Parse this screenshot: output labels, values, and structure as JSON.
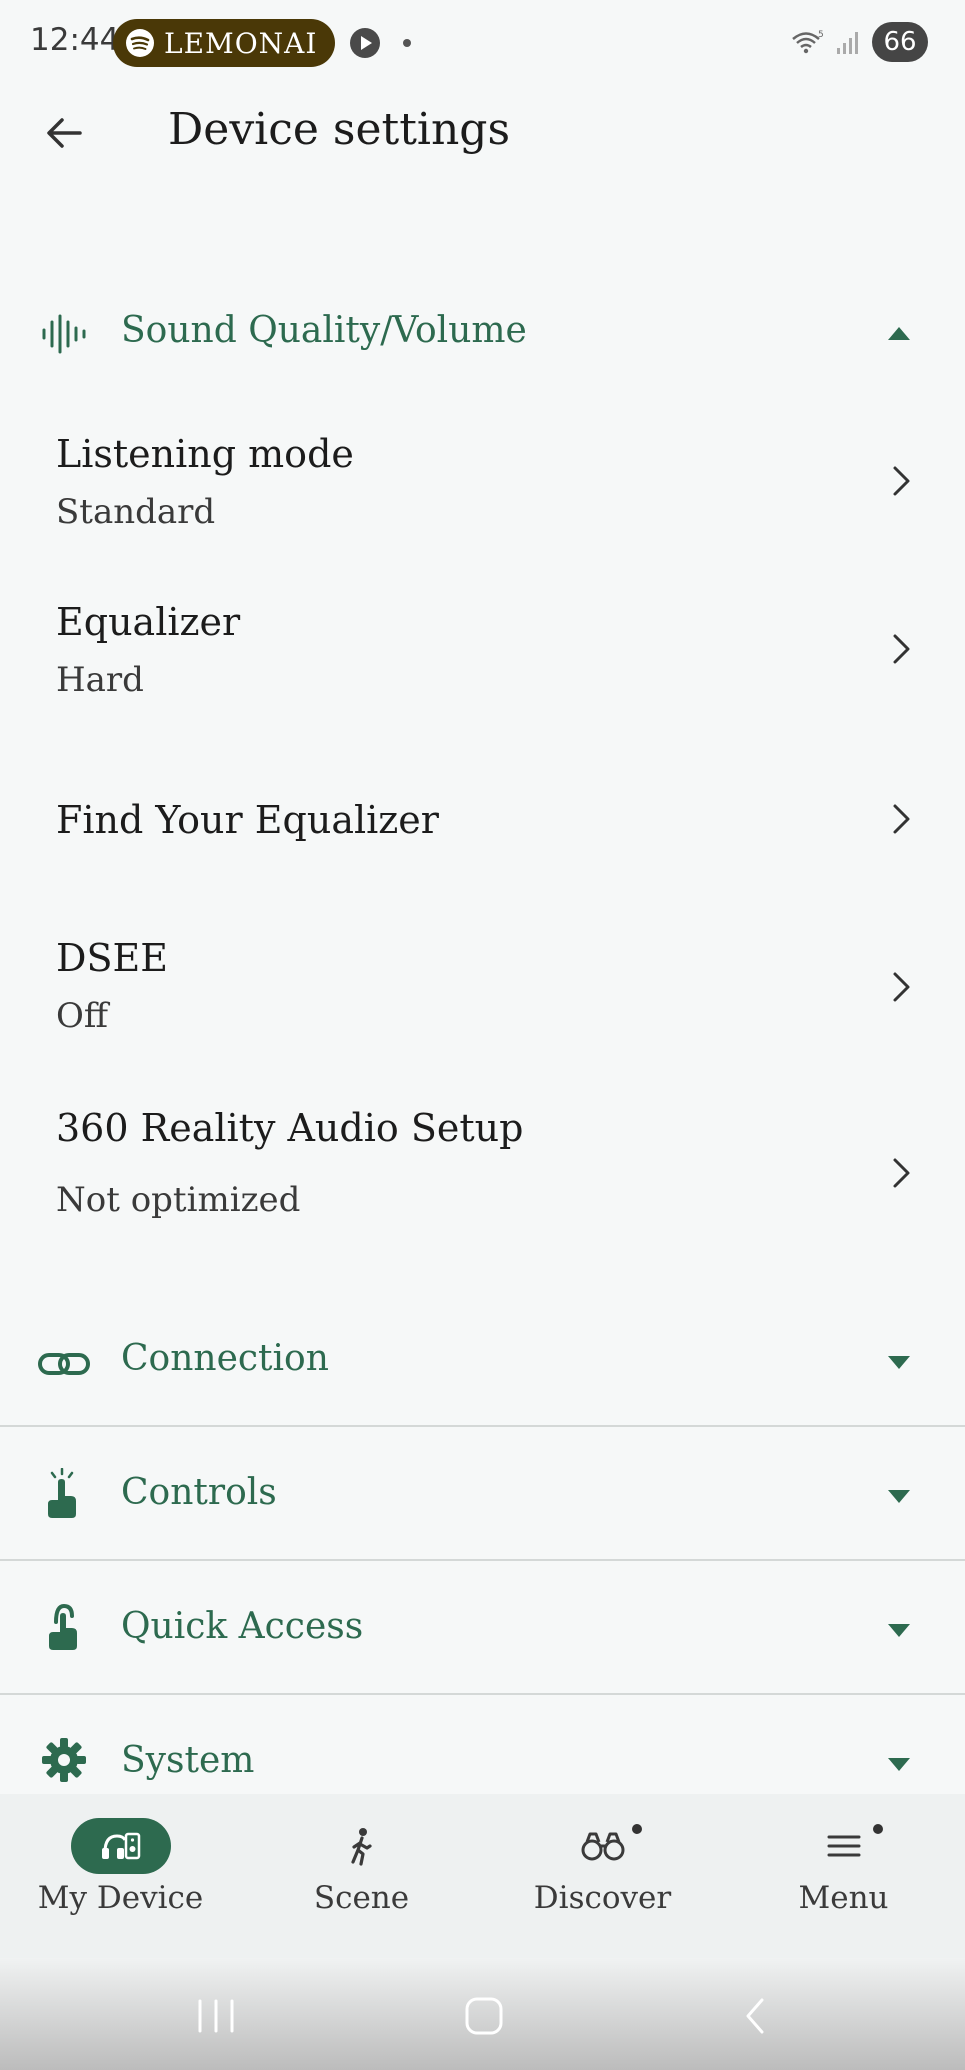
{
  "status_bar": {
    "time": "12:44",
    "spotify_text": "LEMONAI",
    "battery": "66"
  },
  "header": {
    "title": "Device settings"
  },
  "sound_section": {
    "label": "Sound Quality/Volume",
    "expanded": true,
    "items": [
      {
        "title": "Listening mode",
        "value": "Standard"
      },
      {
        "title": "Equalizer",
        "value": "Hard"
      },
      {
        "title": "Find Your Equalizer",
        "value": ""
      },
      {
        "title": "DSEE",
        "value": "Off"
      },
      {
        "title": "360 Reality Audio Setup",
        "value": "Not optimized"
      }
    ]
  },
  "sections": [
    {
      "label": "Connection",
      "icon": "link-icon"
    },
    {
      "label": "Controls",
      "icon": "touch-icon"
    },
    {
      "label": "Quick Access",
      "icon": "quick-access-icon"
    },
    {
      "label": "System",
      "icon": "gear-icon"
    }
  ],
  "bottom_nav": {
    "items": [
      {
        "label": "My Device",
        "icon": "headphones-device-icon",
        "active": true
      },
      {
        "label": "Scene",
        "icon": "walking-person-icon"
      },
      {
        "label": "Discover",
        "icon": "binoculars-icon"
      },
      {
        "label": "Menu",
        "icon": "menu-icon"
      }
    ]
  },
  "colors": {
    "accent": "#2d6a4f",
    "background": "#f6f8f8",
    "spotify_pill": "#4a3807"
  }
}
